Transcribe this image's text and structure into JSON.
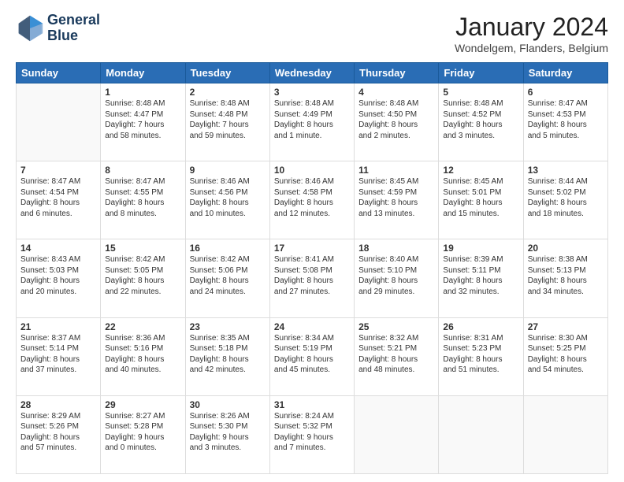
{
  "logo": {
    "line1": "General",
    "line2": "Blue"
  },
  "title": "January 2024",
  "location": "Wondelgem, Flanders, Belgium",
  "weekdays": [
    "Sunday",
    "Monday",
    "Tuesday",
    "Wednesday",
    "Thursday",
    "Friday",
    "Saturday"
  ],
  "weeks": [
    [
      {
        "day": "",
        "info": ""
      },
      {
        "day": "1",
        "info": "Sunrise: 8:48 AM\nSunset: 4:47 PM\nDaylight: 7 hours\nand 58 minutes."
      },
      {
        "day": "2",
        "info": "Sunrise: 8:48 AM\nSunset: 4:48 PM\nDaylight: 7 hours\nand 59 minutes."
      },
      {
        "day": "3",
        "info": "Sunrise: 8:48 AM\nSunset: 4:49 PM\nDaylight: 8 hours\nand 1 minute."
      },
      {
        "day": "4",
        "info": "Sunrise: 8:48 AM\nSunset: 4:50 PM\nDaylight: 8 hours\nand 2 minutes."
      },
      {
        "day": "5",
        "info": "Sunrise: 8:48 AM\nSunset: 4:52 PM\nDaylight: 8 hours\nand 3 minutes."
      },
      {
        "day": "6",
        "info": "Sunrise: 8:47 AM\nSunset: 4:53 PM\nDaylight: 8 hours\nand 5 minutes."
      }
    ],
    [
      {
        "day": "7",
        "info": "Sunrise: 8:47 AM\nSunset: 4:54 PM\nDaylight: 8 hours\nand 6 minutes."
      },
      {
        "day": "8",
        "info": "Sunrise: 8:47 AM\nSunset: 4:55 PM\nDaylight: 8 hours\nand 8 minutes."
      },
      {
        "day": "9",
        "info": "Sunrise: 8:46 AM\nSunset: 4:56 PM\nDaylight: 8 hours\nand 10 minutes."
      },
      {
        "day": "10",
        "info": "Sunrise: 8:46 AM\nSunset: 4:58 PM\nDaylight: 8 hours\nand 12 minutes."
      },
      {
        "day": "11",
        "info": "Sunrise: 8:45 AM\nSunset: 4:59 PM\nDaylight: 8 hours\nand 13 minutes."
      },
      {
        "day": "12",
        "info": "Sunrise: 8:45 AM\nSunset: 5:01 PM\nDaylight: 8 hours\nand 15 minutes."
      },
      {
        "day": "13",
        "info": "Sunrise: 8:44 AM\nSunset: 5:02 PM\nDaylight: 8 hours\nand 18 minutes."
      }
    ],
    [
      {
        "day": "14",
        "info": "Sunrise: 8:43 AM\nSunset: 5:03 PM\nDaylight: 8 hours\nand 20 minutes."
      },
      {
        "day": "15",
        "info": "Sunrise: 8:42 AM\nSunset: 5:05 PM\nDaylight: 8 hours\nand 22 minutes."
      },
      {
        "day": "16",
        "info": "Sunrise: 8:42 AM\nSunset: 5:06 PM\nDaylight: 8 hours\nand 24 minutes."
      },
      {
        "day": "17",
        "info": "Sunrise: 8:41 AM\nSunset: 5:08 PM\nDaylight: 8 hours\nand 27 minutes."
      },
      {
        "day": "18",
        "info": "Sunrise: 8:40 AM\nSunset: 5:10 PM\nDaylight: 8 hours\nand 29 minutes."
      },
      {
        "day": "19",
        "info": "Sunrise: 8:39 AM\nSunset: 5:11 PM\nDaylight: 8 hours\nand 32 minutes."
      },
      {
        "day": "20",
        "info": "Sunrise: 8:38 AM\nSunset: 5:13 PM\nDaylight: 8 hours\nand 34 minutes."
      }
    ],
    [
      {
        "day": "21",
        "info": "Sunrise: 8:37 AM\nSunset: 5:14 PM\nDaylight: 8 hours\nand 37 minutes."
      },
      {
        "day": "22",
        "info": "Sunrise: 8:36 AM\nSunset: 5:16 PM\nDaylight: 8 hours\nand 40 minutes."
      },
      {
        "day": "23",
        "info": "Sunrise: 8:35 AM\nSunset: 5:18 PM\nDaylight: 8 hours\nand 42 minutes."
      },
      {
        "day": "24",
        "info": "Sunrise: 8:34 AM\nSunset: 5:19 PM\nDaylight: 8 hours\nand 45 minutes."
      },
      {
        "day": "25",
        "info": "Sunrise: 8:32 AM\nSunset: 5:21 PM\nDaylight: 8 hours\nand 48 minutes."
      },
      {
        "day": "26",
        "info": "Sunrise: 8:31 AM\nSunset: 5:23 PM\nDaylight: 8 hours\nand 51 minutes."
      },
      {
        "day": "27",
        "info": "Sunrise: 8:30 AM\nSunset: 5:25 PM\nDaylight: 8 hours\nand 54 minutes."
      }
    ],
    [
      {
        "day": "28",
        "info": "Sunrise: 8:29 AM\nSunset: 5:26 PM\nDaylight: 8 hours\nand 57 minutes."
      },
      {
        "day": "29",
        "info": "Sunrise: 8:27 AM\nSunset: 5:28 PM\nDaylight: 9 hours\nand 0 minutes."
      },
      {
        "day": "30",
        "info": "Sunrise: 8:26 AM\nSunset: 5:30 PM\nDaylight: 9 hours\nand 3 minutes."
      },
      {
        "day": "31",
        "info": "Sunrise: 8:24 AM\nSunset: 5:32 PM\nDaylight: 9 hours\nand 7 minutes."
      },
      {
        "day": "",
        "info": ""
      },
      {
        "day": "",
        "info": ""
      },
      {
        "day": "",
        "info": ""
      }
    ]
  ]
}
